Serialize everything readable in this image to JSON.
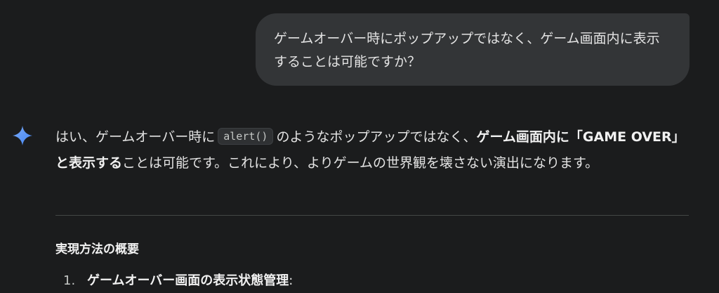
{
  "user_message": {
    "text": "ゲームオーバー時にポップアップではなく、ゲーム画面内に表示することは可能ですか？"
  },
  "assistant": {
    "icon": "gemini-sparkle-icon",
    "accent_colors": [
      "#4285f4",
      "#7baaf7"
    ],
    "paragraph": {
      "part1": "はい、ゲームオーバー時に",
      "code": "alert()",
      "part2": "のようなポップアップではなく、",
      "bold": "ゲーム画面内に「GAME OVER」と表示する",
      "part3": "ことは可能です。これにより、よりゲームの世界観を壊さない演出になります。"
    },
    "section_heading": "実現方法の概要",
    "list": [
      {
        "number": "1.",
        "label": "ゲームオーバー画面の表示状態管理",
        "suffix": ":"
      }
    ]
  }
}
